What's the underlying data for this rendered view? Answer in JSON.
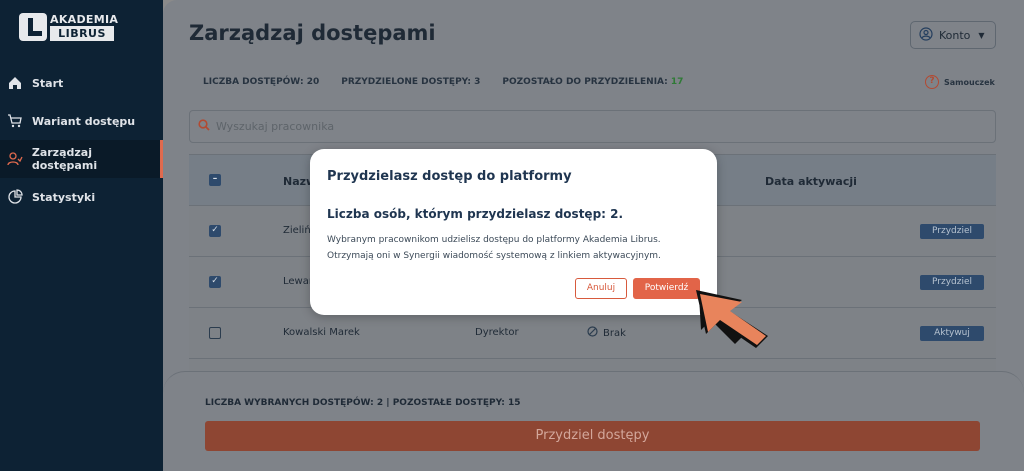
{
  "sidebar": {
    "logo": {
      "line1": "AKADEMIA",
      "line2": "LIBRUS"
    },
    "items": [
      {
        "label": "Start",
        "icon": "home-icon"
      },
      {
        "label": "Wariant dostępu",
        "icon": "cart-icon"
      },
      {
        "label": "Zarządzaj dostępami",
        "icon": "users-icon",
        "active": true
      },
      {
        "label": "Statystyki",
        "icon": "pie-chart-icon"
      }
    ]
  },
  "header": {
    "title": "Zarządzaj dostępami",
    "account_label": "Konto",
    "tutorial_label": "Samouczek"
  },
  "stats": {
    "total_label": "LICZBA DOSTĘPÓW:",
    "total_value": "20",
    "assigned_label": "PRZYDZIELONE DOSTĘPY:",
    "assigned_value": "3",
    "remaining_label": "POZOSTAŁO DO PRZYDZIELENIA:",
    "remaining_value": "17"
  },
  "search": {
    "placeholder": "Wyszukaj pracownika"
  },
  "table": {
    "columns": {
      "name": "Nazw",
      "activation_date": "Data aktywacji"
    },
    "rows": [
      {
        "name": "Zieliń",
        "checked": true,
        "action": "Przydziel"
      },
      {
        "name": "Lewar",
        "checked": true,
        "action": "Przydziel"
      },
      {
        "name": "Kowalski Marek",
        "role": "Dyrektor",
        "status": "Brak",
        "checked": false,
        "action": "Aktywuj"
      }
    ]
  },
  "footer": {
    "selection_label": "LICZBA WYBRANYCH DOSTĘPÓW: 2 | POZOSTAŁE DOSTĘPY: 15",
    "assign_button": "Przydziel dostępy"
  },
  "modal": {
    "title": "Przydzielasz dostęp do platformy",
    "subtitle": "Liczba osób, którym przydzielasz dostęp: 2.",
    "body_line1": "Wybranym pracownikom udzielisz dostępu do platformy Akademia Librus.",
    "body_line2": "Otrzymają oni w Synergii wiadomość systemową z linkiem aktywacyjnym.",
    "cancel": "Anuluj",
    "confirm": "Potwierdź"
  },
  "colors": {
    "sidebar_bg": "#0d2234",
    "accent": "#e26448",
    "primary_button": "#2e4a6c",
    "remaining_green": "#2f7a36"
  }
}
